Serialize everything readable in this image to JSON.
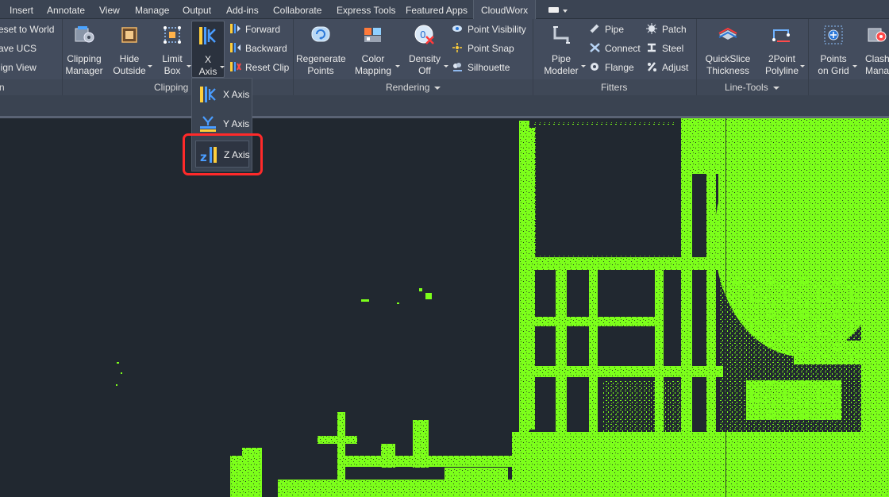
{
  "tabs": [
    {
      "label": "Insert",
      "active": false
    },
    {
      "label": "Annotate",
      "active": false
    },
    {
      "label": "View",
      "active": false
    },
    {
      "label": "Manage",
      "active": false
    },
    {
      "label": "Output",
      "active": false
    },
    {
      "label": "Add-ins",
      "active": false
    },
    {
      "label": "Collaborate",
      "active": false
    },
    {
      "label": "Express Tools",
      "active": false
    },
    {
      "label": "Featured Apps",
      "active": false
    },
    {
      "label": "CloudWorx",
      "active": true
    }
  ],
  "ucs_panel": {
    "items": [
      "eset to World",
      "ave UCS",
      "lign View"
    ],
    "title": "n"
  },
  "clipping": {
    "title": "Clipping",
    "buttons": {
      "clipping_manager": "Clipping\nManager",
      "hide_outside": "Hide\nOutside",
      "limit_box": "Limit\nBox",
      "x_axis": "X\nAxis"
    },
    "small": [
      "Forward",
      "Backward",
      "Reset Clip"
    ]
  },
  "rendering": {
    "title": "Rendering",
    "buttons": {
      "regenerate_points": "Regenerate\nPoints",
      "color_mapping": "Color\nMapping",
      "density_off": "Density\nOff"
    },
    "small": [
      "Point Visibility",
      "Point Snap",
      "Silhouette"
    ]
  },
  "fitters": {
    "title": "Fitters",
    "buttons": {
      "pipe_modeler": "Pipe\nModeler"
    },
    "small_col1": [
      "Pipe",
      "Connect",
      "Flange"
    ],
    "small_col2": [
      "Patch",
      "Steel",
      "Adjust"
    ]
  },
  "line_tools": {
    "title": "Line-Tools",
    "buttons": {
      "quickslice_thickness": "QuickSlice\nThickness",
      "twopoint_polyline": "2Point\nPolyline"
    }
  },
  "grid_panel": {
    "buttons": {
      "points_on_grid": "Points\non Grid",
      "clash_manager": "Clash\nManag"
    }
  },
  "axis_dropdown": {
    "items": [
      "X Axis",
      "Y Axis",
      "Z Axis"
    ],
    "highlighted": "Z Axis"
  },
  "colors": {
    "point_cloud": "#7cff1a",
    "highlight_box": "#ff2a2a",
    "viewport_bg": "#212830",
    "ribbon_bg": "#434c5d"
  }
}
